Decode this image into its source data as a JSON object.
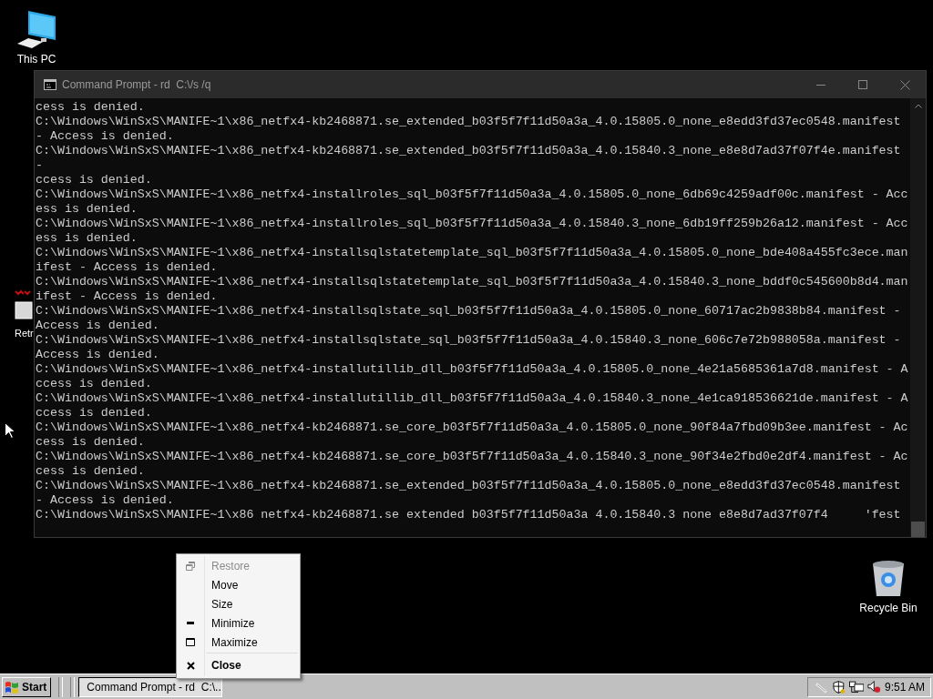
{
  "desktop_icons": [
    {
      "label": "This PC",
      "kind": "computer"
    },
    {
      "label": "Retr",
      "kind": "partial"
    },
    {
      "label": "Recycle Bin",
      "kind": "recycle"
    }
  ],
  "window": {
    "title": "Command Prompt - rd  C:\\/s /q",
    "lines": [
      "cess is denied.",
      "C:\\Windows\\WinSxS\\MANIFE~1\\x86_netfx4-kb2468871.se_extended_b03f5f7f11d50a3a_4.0.15805.0_none_e8edd3fd37ec0548.manifest",
      "- Access is denied.",
      "C:\\Windows\\WinSxS\\MANIFE~1\\x86_netfx4-kb2468871.se_extended_b03f5f7f11d50a3a_4.0.15840.3_none_e8e8d7ad37f07f4e.manifest",
      "-",
      "ccess is denied.",
      "C:\\Windows\\WinSxS\\MANIFE~1\\x86_netfx4-installroles_sql_b03f5f7f11d50a3a_4.0.15805.0_none_6db69c4259adf00c.manifest - Acc",
      "ess is denied.",
      "C:\\Windows\\WinSxS\\MANIFE~1\\x86_netfx4-installroles_sql_b03f5f7f11d50a3a_4.0.15840.3_none_6db19ff259b26a12.manifest - Acc",
      "ess is denied.",
      "C:\\Windows\\WinSxS\\MANIFE~1\\x86_netfx4-installsqlstatetemplate_sql_b03f5f7f11d50a3a_4.0.15805.0_none_bde408a455fc3ece.man",
      "ifest - Access is denied.",
      "C:\\Windows\\WinSxS\\MANIFE~1\\x86_netfx4-installsqlstatetemplate_sql_b03f5f7f11d50a3a_4.0.15840.3_none_bddf0c545600b8d4.man",
      "ifest - Access is denied.",
      "C:\\Windows\\WinSxS\\MANIFE~1\\x86_netfx4-installsqlstate_sql_b03f5f7f11d50a3a_4.0.15805.0_none_60717ac2b9838b84.manifest -",
      "Access is denied.",
      "C:\\Windows\\WinSxS\\MANIFE~1\\x86_netfx4-installsqlstate_sql_b03f5f7f11d50a3a_4.0.15840.3_none_606c7e72b988058a.manifest -",
      "Access is denied.",
      "C:\\Windows\\WinSxS\\MANIFE~1\\x86_netfx4-installutillib_dll_b03f5f7f11d50a3a_4.0.15805.0_none_4e21a5685361a7d8.manifest - A",
      "ccess is denied.",
      "C:\\Windows\\WinSxS\\MANIFE~1\\x86_netfx4-installutillib_dll_b03f5f7f11d50a3a_4.0.15840.3_none_4e1ca918536621de.manifest - A",
      "ccess is denied.",
      "C:\\Windows\\WinSxS\\MANIFE~1\\x86_netfx4-kb2468871.se_core_b03f5f7f11d50a3a_4.0.15805.0_none_90f84a7fbd09b3ee.manifest - Ac",
      "cess is denied.",
      "C:\\Windows\\WinSxS\\MANIFE~1\\x86_netfx4-kb2468871.se_core_b03f5f7f11d50a3a_4.0.15840.3_none_90f34e2fbd0e2df4.manifest - Ac",
      "cess is denied.",
      "C:\\Windows\\WinSxS\\MANIFE~1\\x86_netfx4-kb2468871.se_extended_b03f5f7f11d50a3a_4.0.15805.0_none_e8edd3fd37ec0548.manifest",
      "- Access is denied.",
      "C:\\Windows\\WinSxS\\MANIFE~1\\x86 netfx4-kb2468871.se extended b03f5f7f11d50a3a 4.0.15840.3 none e8e8d7ad37f07f4     'fest"
    ]
  },
  "context_menu": {
    "items": [
      {
        "label": "Restore",
        "kind": "restore",
        "disabled": true,
        "default": false,
        "separator_before": false
      },
      {
        "label": "Move",
        "kind": "move",
        "disabled": false,
        "default": false,
        "separator_before": false
      },
      {
        "label": "Size",
        "kind": "size",
        "disabled": false,
        "default": false,
        "separator_before": false
      },
      {
        "label": "Minimize",
        "kind": "minimize",
        "disabled": false,
        "default": false,
        "separator_before": false
      },
      {
        "label": "Maximize",
        "kind": "maximize",
        "disabled": false,
        "default": false,
        "separator_before": false
      },
      {
        "label": "Close",
        "kind": "close",
        "disabled": false,
        "default": true,
        "separator_before": true
      }
    ]
  },
  "taskbar": {
    "start": "Start",
    "tasks": [
      {
        "label": "Command Prompt - rd  C:\\...",
        "selected": true
      }
    ],
    "clock": "9:51 AM"
  }
}
